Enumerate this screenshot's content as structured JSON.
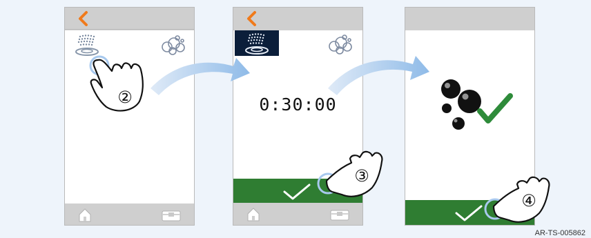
{
  "screens": [
    {
      "id": "screen-1",
      "step_number": "②",
      "icons": [
        "shower-wash-icon",
        "foam-bubbles-icon"
      ]
    },
    {
      "id": "screen-2",
      "timer": "0:30:00",
      "step_number": "③",
      "icons": [
        "shower-wash-icon-selected",
        "foam-bubbles-icon"
      ]
    },
    {
      "id": "screen-3",
      "step_number": "④",
      "icons": [
        "black-bubbles-icon",
        "green-check-icon"
      ]
    }
  ],
  "footer": {
    "document_code": "AR-TS-005862"
  },
  "colors": {
    "back_arrow": "#f07a1b",
    "confirm_green": "#2f7d32",
    "check_green": "#2e8b3a",
    "flow_arrow": "#9cc3ea",
    "selected_tile": "#0b1e3a"
  }
}
